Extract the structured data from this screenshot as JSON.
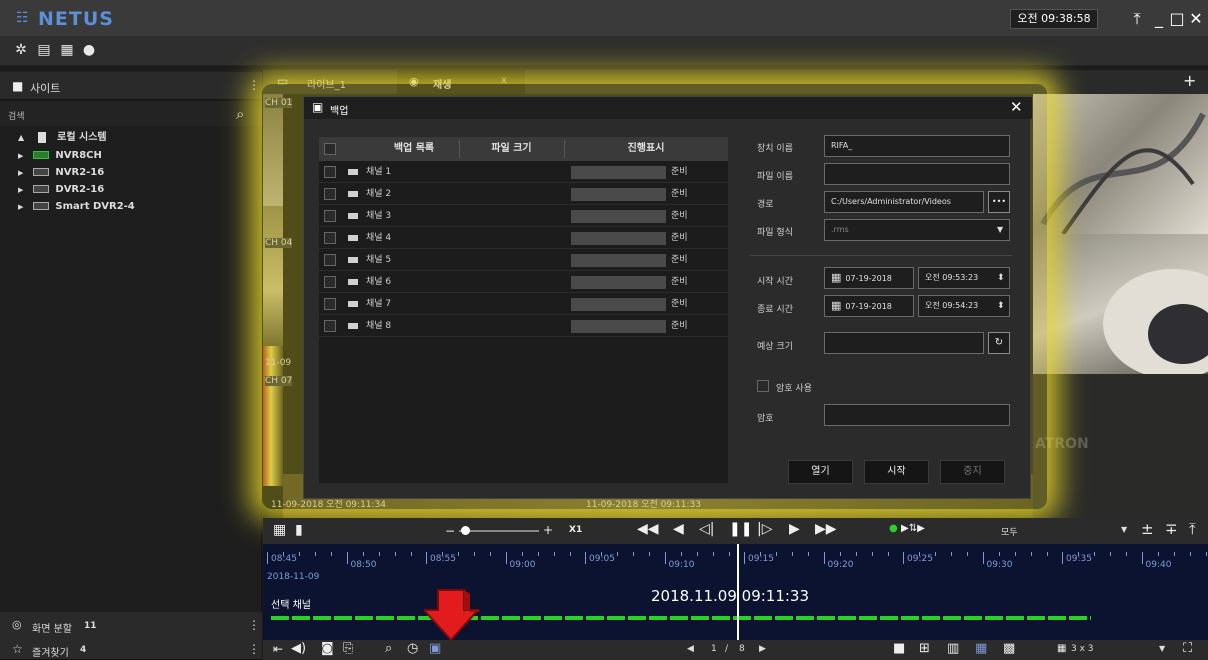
{
  "app": {
    "name": "NETUS",
    "clock": "오전 09:38:58"
  },
  "sidebar": {
    "site_label": "사이트",
    "search_label": "검색",
    "tree_root": "로컬 시스템",
    "devices": [
      {
        "name": "NVR8CH"
      },
      {
        "name": "NVR2-16"
      },
      {
        "name": "DVR2-16"
      },
      {
        "name": "Smart DVR2-4"
      }
    ],
    "screen_split_label": "화면 분할",
    "screen_split_count": "11",
    "favorites_label": "즐겨찾기",
    "favorites_count": "4"
  },
  "tabs": [
    {
      "label": "라이브_1"
    },
    {
      "label": "재생",
      "close": "x"
    }
  ],
  "video": {
    "channels": [
      "CH 01",
      "CH 04",
      "CH 07"
    ],
    "timestamps": [
      "11-09",
      "11-09",
      "11-09-2018 오전 09:11:34",
      "11-09-2018 오전 09:11:33"
    ],
    "watermark": "ATRON"
  },
  "dialog": {
    "title": "백업",
    "columns": {
      "list": "백업 목록",
      "size": "파일 크기",
      "progress": "진행표시"
    },
    "rows": [
      {
        "label": "채널 1",
        "status": "준비"
      },
      {
        "label": "채널 2",
        "status": "준비"
      },
      {
        "label": "채널 3",
        "status": "준비"
      },
      {
        "label": "채널 4",
        "status": "준비"
      },
      {
        "label": "채널 5",
        "status": "준비"
      },
      {
        "label": "채널 6",
        "status": "준비"
      },
      {
        "label": "채널 7",
        "status": "준비"
      },
      {
        "label": "채널 8",
        "status": "준비"
      }
    ],
    "fields": {
      "device_name_label": "장치 이름",
      "device_name_value": "RIFA_",
      "file_name_label": "파일 이름",
      "file_name_value": "",
      "path_label": "경로",
      "path_value": "C:/Users/Administrator/Videos",
      "browse": "•••",
      "format_label": "파일 형식",
      "format_value": ".rms",
      "start_label": "시작 시간",
      "start_date": "07-19-2018",
      "start_time": "오전 09:53:23",
      "end_label": "종료 시간",
      "end_date": "07-19-2018",
      "end_time": "오전 09:54:23",
      "est_label": "예상 크기",
      "est_value": "",
      "password_use_label": "암호 사용",
      "password_label": "암호",
      "password_value": ""
    },
    "buttons": {
      "open": "열기",
      "start": "시작",
      "stop": "중지"
    }
  },
  "playback": {
    "speed": "X1",
    "filter": "모두",
    "date": "2018-11-09",
    "selected_channel": "선택 채널",
    "current_time": "2018.11.09  09:11:33",
    "ticks": [
      "08:45",
      "08:50",
      "08:55",
      "09:00",
      "09:05",
      "09:10",
      "09:15",
      "09:20",
      "09:25",
      "09:30",
      "09:35",
      "09:40"
    ],
    "page_current": "1",
    "page_sep": "/",
    "page_total": "8",
    "layout": "3 x 3"
  },
  "colors": {
    "accent": "#5b8fd6",
    "glow": "#e6d728",
    "record": "#2bd12b",
    "arrow": "#e21c1c"
  }
}
